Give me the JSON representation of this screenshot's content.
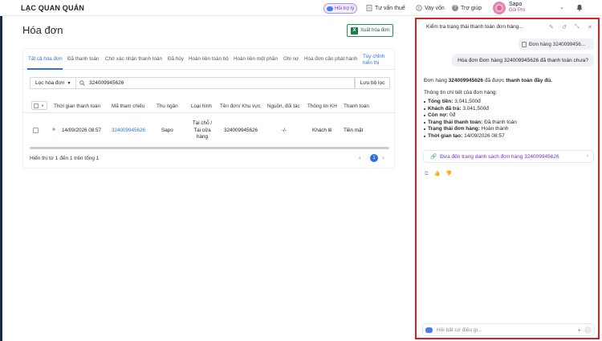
{
  "header": {
    "brand": "LẠC QUAN QUÁN",
    "help_button": "Hỏi trợ lý",
    "tax_advice": "Tư vấn thuế",
    "loan": "Vay vốn",
    "support": "Trợ giúp",
    "store_name": "Sapo",
    "store_plan": "Gói Pro"
  },
  "page": {
    "title": "Hóa đơn",
    "export_label": "Xuất hóa đơn"
  },
  "tabs": [
    "Tất cả hóa đơn",
    "Đã thanh toán",
    "Chờ xác nhận thanh toán",
    "Đã hủy",
    "Hoàn tiền toàn bộ",
    "Hoàn tiền một phần",
    "Ghi nợ",
    "Hóa đơn cần phát hành",
    "Tùy chỉnh hiển thị"
  ],
  "filter": {
    "select_label": "Lọc hóa đơn",
    "search_value": "324009945626",
    "save_label": "Lưu bộ lọc"
  },
  "table": {
    "columns": [
      "Thời gian thanh toán",
      "Mã tham chiếu",
      "Thu ngân",
      "Loại hình",
      "Tên đơn/ Khu vực",
      "Nguồn, đối tác",
      "Thông tin KH",
      "Thanh toán"
    ],
    "rows": [
      {
        "paid_time": "14/09/2026 08:57",
        "reference": "324009945626",
        "cashier": "Sapo",
        "type": "Tại chỗ / Tại cửa hàng",
        "order_name": "324009945626",
        "source": "-/-",
        "customer": "Khách lẻ",
        "payment": "Tiền mặt"
      }
    ]
  },
  "pagination": {
    "summary": "Hiển thị từ 1 đến 1 trên tổng 1",
    "current": "1"
  },
  "chat": {
    "title": "Kiểm tra trạng thái thanh toán đơn hàng...",
    "order_chip": "Đơn hàng 3240099456...",
    "user_message": "Hóa đơn Đơn hàng 324009945626 đã thanh toán chưa?",
    "answer_intro_pre": "Đơn hàng ",
    "answer_intro_order": "324009945626",
    "answer_intro_mid": " đã được ",
    "answer_intro_status": "thanh toán đầy đủ.",
    "details_heading": "Thông tin chi tiết của đơn hàng:",
    "details": [
      {
        "label": "Tổng tiền:",
        "value": "3,041,500đ"
      },
      {
        "label": "Khách đã trả:",
        "value": "3,041,500đ"
      },
      {
        "label": "Còn nợ:",
        "value": "0đ"
      },
      {
        "label": "Trạng thái thanh toán:",
        "value": "Đã thanh toán"
      },
      {
        "label": "Trạng thái đơn hàng:",
        "value": "Hoàn thành"
      },
      {
        "label": "Thời gian tạo:",
        "value": "14/09/2026 08:57"
      }
    ],
    "go_link": "Đưa đến trang danh sách đơn hàng 324009945626",
    "input_placeholder": "Hỏi bất cứ điều gì..."
  },
  "colors": {
    "accent": "#2f6fe0",
    "ai_purple": "#6b33c7",
    "highlight_border": "#e02020",
    "excel_green": "#1f7a45"
  }
}
